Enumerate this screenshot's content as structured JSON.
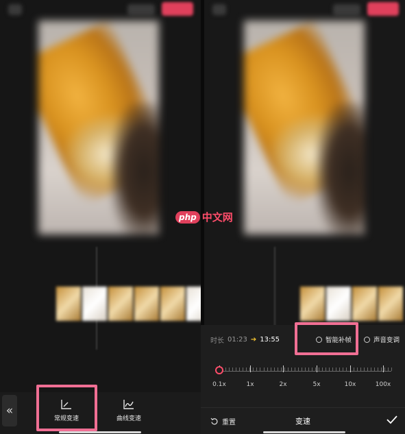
{
  "watermark": {
    "badge": "php",
    "text": "中文网"
  },
  "left_toolbar": {
    "back_icon": "«",
    "tools": [
      {
        "label": "常规变速",
        "icon": "normal-speed-icon"
      },
      {
        "label": "曲线变速",
        "icon": "curve-speed-icon"
      }
    ]
  },
  "speed_panel": {
    "duration_label": "时长",
    "duration_old": "01:23",
    "duration_arrow": "➔",
    "duration_new": "13:55",
    "options": [
      {
        "label": "智能补帧",
        "checked": false
      },
      {
        "label": "声音变调",
        "checked": false
      }
    ],
    "speed_marks": [
      "0.1x",
      "1x",
      "2x",
      "5x",
      "10x",
      "100x"
    ],
    "current_speed_fraction": 0.0,
    "reset_label": "重置",
    "title": "变速"
  },
  "colors": {
    "accent": "#ff4d6a",
    "highlight": "#f06f94",
    "arrow": "#f2c230"
  }
}
